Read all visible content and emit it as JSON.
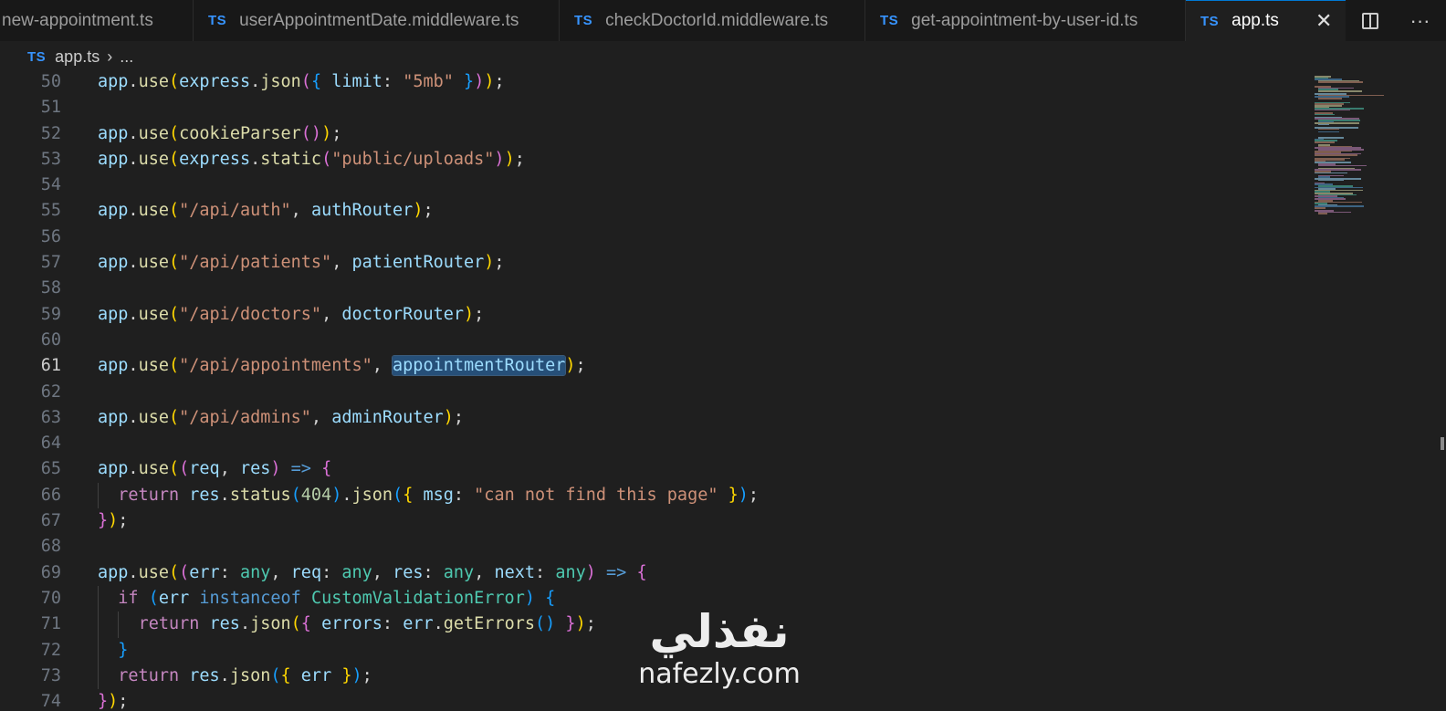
{
  "tabs": [
    {
      "badge": "",
      "label": "new-appointment.ts"
    },
    {
      "badge": "TS",
      "label": "userAppointmentDate.middleware.ts"
    },
    {
      "badge": "TS",
      "label": "checkDoctorId.middleware.ts"
    },
    {
      "badge": "TS",
      "label": "get-appointment-by-user-id.ts"
    },
    {
      "badge": "TS",
      "label": "app.ts",
      "active": true,
      "close": "✕"
    }
  ],
  "tab_actions": {
    "split_icon": "split-editor-icon",
    "more": "···"
  },
  "breadcrumb": {
    "badge": "TS",
    "file": "app.ts",
    "sep": "›",
    "rest": "..."
  },
  "line_numbers": [
    "50",
    "51",
    "52",
    "53",
    "54",
    "55",
    "56",
    "57",
    "58",
    "59",
    "60",
    "61",
    "62",
    "63",
    "64",
    "65",
    "66",
    "67",
    "68",
    "69",
    "70",
    "71",
    "72",
    "73",
    "74"
  ],
  "current_line": "61",
  "code_lines": [
    [
      [
        "var",
        "app"
      ],
      [
        "pun",
        "."
      ],
      [
        "fn",
        "use"
      ],
      [
        "p1",
        "("
      ],
      [
        "var",
        "express"
      ],
      [
        "pun",
        "."
      ],
      [
        "fn",
        "json"
      ],
      [
        "p2",
        "("
      ],
      [
        "p3",
        "{"
      ],
      [
        "pun",
        " "
      ],
      [
        "var",
        "limit"
      ],
      [
        "pun",
        ": "
      ],
      [
        "str",
        "\"5mb\""
      ],
      [
        "pun",
        " "
      ],
      [
        "p3",
        "}"
      ],
      [
        "p2",
        ")"
      ],
      [
        "p1",
        ")"
      ],
      [
        "pun",
        ";"
      ]
    ],
    [],
    [
      [
        "var",
        "app"
      ],
      [
        "pun",
        "."
      ],
      [
        "fn",
        "use"
      ],
      [
        "p1",
        "("
      ],
      [
        "fn",
        "cookieParser"
      ],
      [
        "p2",
        "()"
      ],
      [
        "p1",
        ")"
      ],
      [
        "pun",
        ";"
      ]
    ],
    [
      [
        "var",
        "app"
      ],
      [
        "pun",
        "."
      ],
      [
        "fn",
        "use"
      ],
      [
        "p1",
        "("
      ],
      [
        "var",
        "express"
      ],
      [
        "pun",
        "."
      ],
      [
        "fn",
        "static"
      ],
      [
        "p2",
        "("
      ],
      [
        "str",
        "\"public/uploads\""
      ],
      [
        "p2",
        ")"
      ],
      [
        "p1",
        ")"
      ],
      [
        "pun",
        ";"
      ]
    ],
    [],
    [
      [
        "var",
        "app"
      ],
      [
        "pun",
        "."
      ],
      [
        "fn",
        "use"
      ],
      [
        "p1",
        "("
      ],
      [
        "str",
        "\"/api/auth\""
      ],
      [
        "pun",
        ", "
      ],
      [
        "var",
        "authRouter"
      ],
      [
        "p1",
        ")"
      ],
      [
        "pun",
        ";"
      ]
    ],
    [],
    [
      [
        "var",
        "app"
      ],
      [
        "pun",
        "."
      ],
      [
        "fn",
        "use"
      ],
      [
        "p1",
        "("
      ],
      [
        "str",
        "\"/api/patients\""
      ],
      [
        "pun",
        ", "
      ],
      [
        "var",
        "patientRouter"
      ],
      [
        "p1",
        ")"
      ],
      [
        "pun",
        ";"
      ]
    ],
    [],
    [
      [
        "var",
        "app"
      ],
      [
        "pun",
        "."
      ],
      [
        "fn",
        "use"
      ],
      [
        "p1",
        "("
      ],
      [
        "str",
        "\"/api/doctors\""
      ],
      [
        "pun",
        ", "
      ],
      [
        "var",
        "doctorRouter"
      ],
      [
        "p1",
        ")"
      ],
      [
        "pun",
        ";"
      ]
    ],
    [],
    [
      [
        "var",
        "app"
      ],
      [
        "pun",
        "."
      ],
      [
        "fn",
        "use"
      ],
      [
        "p1",
        "("
      ],
      [
        "str",
        "\"/api/appointments\""
      ],
      [
        "pun",
        ", "
      ],
      [
        "hl",
        "appointmentRouter"
      ],
      [
        "p1",
        ")"
      ],
      [
        "pun",
        ";"
      ]
    ],
    [],
    [
      [
        "var",
        "app"
      ],
      [
        "pun",
        "."
      ],
      [
        "fn",
        "use"
      ],
      [
        "p1",
        "("
      ],
      [
        "str",
        "\"/api/admins\""
      ],
      [
        "pun",
        ", "
      ],
      [
        "var",
        "adminRouter"
      ],
      [
        "p1",
        ")"
      ],
      [
        "pun",
        ";"
      ]
    ],
    [],
    [
      [
        "var",
        "app"
      ],
      [
        "pun",
        "."
      ],
      [
        "fn",
        "use"
      ],
      [
        "p1",
        "("
      ],
      [
        "p2",
        "("
      ],
      [
        "var",
        "req"
      ],
      [
        "pun",
        ", "
      ],
      [
        "var",
        "res"
      ],
      [
        "p2",
        ")"
      ],
      [
        "pun",
        " "
      ],
      [
        "kw2",
        "=>"
      ],
      [
        "pun",
        " "
      ],
      [
        "p2",
        "{"
      ]
    ],
    [
      [
        "pun",
        "  "
      ],
      [
        "kw",
        "return"
      ],
      [
        "pun",
        " "
      ],
      [
        "var",
        "res"
      ],
      [
        "pun",
        "."
      ],
      [
        "fn",
        "status"
      ],
      [
        "p3",
        "("
      ],
      [
        "num",
        "404"
      ],
      [
        "p3",
        ")"
      ],
      [
        "pun",
        "."
      ],
      [
        "fn",
        "json"
      ],
      [
        "p3",
        "("
      ],
      [
        "p1",
        "{"
      ],
      [
        "pun",
        " "
      ],
      [
        "var",
        "msg"
      ],
      [
        "pun",
        ": "
      ],
      [
        "str",
        "\"can not find this page\""
      ],
      [
        "pun",
        " "
      ],
      [
        "p1",
        "}"
      ],
      [
        "p3",
        ")"
      ],
      [
        "pun",
        ";"
      ]
    ],
    [
      [
        "p2",
        "}"
      ],
      [
        "p1",
        ")"
      ],
      [
        "pun",
        ";"
      ]
    ],
    [],
    [
      [
        "var",
        "app"
      ],
      [
        "pun",
        "."
      ],
      [
        "fn",
        "use"
      ],
      [
        "p1",
        "("
      ],
      [
        "p2",
        "("
      ],
      [
        "var",
        "err"
      ],
      [
        "pun",
        ": "
      ],
      [
        "type",
        "any"
      ],
      [
        "pun",
        ", "
      ],
      [
        "var",
        "req"
      ],
      [
        "pun",
        ": "
      ],
      [
        "type",
        "any"
      ],
      [
        "pun",
        ", "
      ],
      [
        "var",
        "res"
      ],
      [
        "pun",
        ": "
      ],
      [
        "type",
        "any"
      ],
      [
        "pun",
        ", "
      ],
      [
        "var",
        "next"
      ],
      [
        "pun",
        ": "
      ],
      [
        "type",
        "any"
      ],
      [
        "p2",
        ")"
      ],
      [
        "pun",
        " "
      ],
      [
        "kw2",
        "=>"
      ],
      [
        "pun",
        " "
      ],
      [
        "p2",
        "{"
      ]
    ],
    [
      [
        "pun",
        "  "
      ],
      [
        "kw",
        "if"
      ],
      [
        "pun",
        " "
      ],
      [
        "p3",
        "("
      ],
      [
        "var",
        "err"
      ],
      [
        "pun",
        " "
      ],
      [
        "kw2",
        "instanceof"
      ],
      [
        "pun",
        " "
      ],
      [
        "type",
        "CustomValidationError"
      ],
      [
        "p3",
        ")"
      ],
      [
        "pun",
        " "
      ],
      [
        "p3",
        "{"
      ]
    ],
    [
      [
        "pun",
        "    "
      ],
      [
        "kw",
        "return"
      ],
      [
        "pun",
        " "
      ],
      [
        "var",
        "res"
      ],
      [
        "pun",
        "."
      ],
      [
        "fn",
        "json"
      ],
      [
        "p1",
        "("
      ],
      [
        "p2",
        "{"
      ],
      [
        "pun",
        " "
      ],
      [
        "var",
        "errors"
      ],
      [
        "pun",
        ": "
      ],
      [
        "var",
        "err"
      ],
      [
        "pun",
        "."
      ],
      [
        "fn",
        "getErrors"
      ],
      [
        "p3",
        "()"
      ],
      [
        "pun",
        " "
      ],
      [
        "p2",
        "}"
      ],
      [
        "p1",
        ")"
      ],
      [
        "pun",
        ";"
      ]
    ],
    [
      [
        "pun",
        "  "
      ],
      [
        "p3",
        "}"
      ]
    ],
    [
      [
        "pun",
        "  "
      ],
      [
        "kw",
        "return"
      ],
      [
        "pun",
        " "
      ],
      [
        "var",
        "res"
      ],
      [
        "pun",
        "."
      ],
      [
        "fn",
        "json"
      ],
      [
        "p3",
        "("
      ],
      [
        "p1",
        "{"
      ],
      [
        "pun",
        " "
      ],
      [
        "var",
        "err"
      ],
      [
        "pun",
        " "
      ],
      [
        "p1",
        "}"
      ],
      [
        "p3",
        ")"
      ],
      [
        "pun",
        ";"
      ]
    ],
    [
      [
        "p2",
        "}"
      ],
      [
        "p1",
        ")"
      ],
      [
        "pun",
        ";"
      ]
    ]
  ],
  "colors": {
    "background": "#1f1f1f",
    "tab_bar": "#181818",
    "ts_badge": "#3794ff",
    "accent": "#0078d4",
    "selection": "#264f78"
  },
  "watermark": {
    "arabic": "نفذلي",
    "latin": "nafezly.com"
  }
}
